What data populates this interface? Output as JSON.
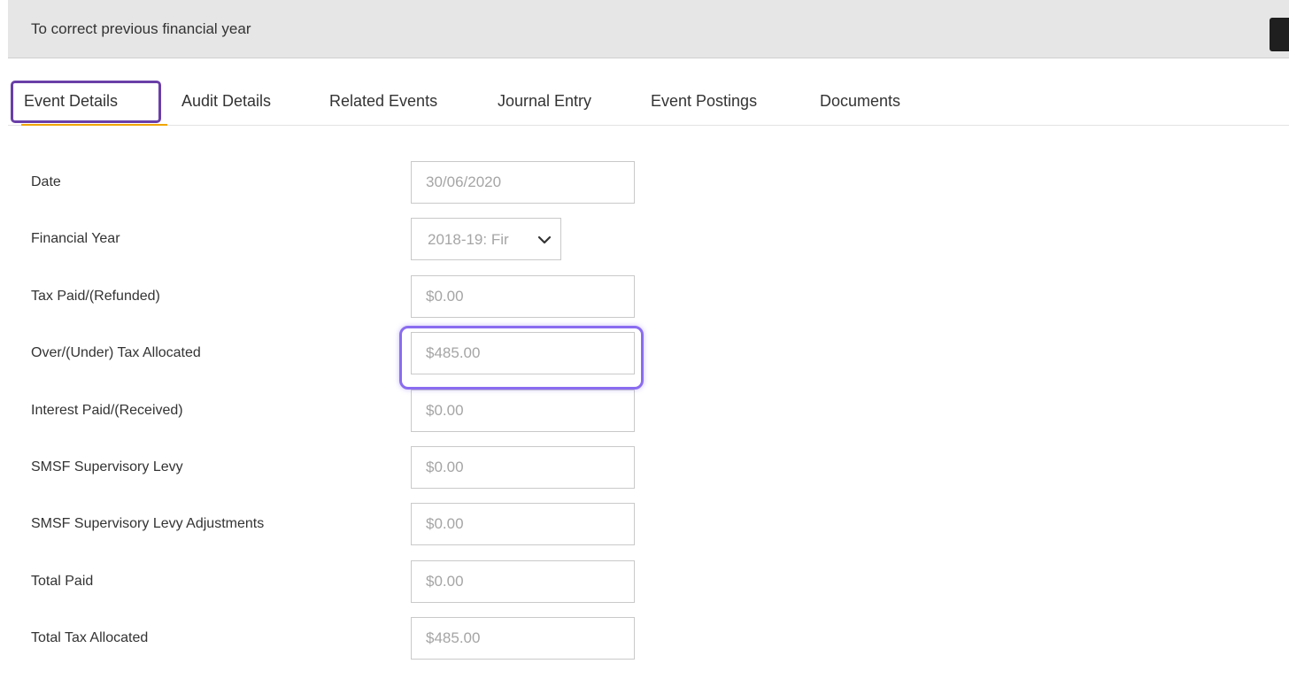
{
  "header": {
    "title": "To correct previous financial year"
  },
  "tabs": [
    {
      "label": "Event Details",
      "active": true
    },
    {
      "label": "Audit Details",
      "active": false
    },
    {
      "label": "Related Events",
      "active": false
    },
    {
      "label": "Journal Entry",
      "active": false
    },
    {
      "label": "Event Postings",
      "active": false
    },
    {
      "label": "Documents",
      "active": false
    }
  ],
  "form": {
    "date": {
      "label": "Date",
      "value": "30/06/2020"
    },
    "financial_year": {
      "label": "Financial Year",
      "value": "2018-19: Fir"
    },
    "tax_paid": {
      "label": "Tax Paid/(Refunded)",
      "value": "$0.00"
    },
    "over_under_tax": {
      "label": "Over/(Under) Tax Allocated",
      "value": "$485.00"
    },
    "interest_paid": {
      "label": "Interest Paid/(Received)",
      "value": "$0.00"
    },
    "smsf_levy": {
      "label": "SMSF Supervisory Levy",
      "value": "$0.00"
    },
    "smsf_levy_adj": {
      "label": "SMSF Supervisory Levy Adjustments",
      "value": "$0.00"
    },
    "total_paid": {
      "label": "Total Paid",
      "value": "$0.00"
    },
    "total_tax_allocated": {
      "label": "Total Tax Allocated",
      "value": "$485.00"
    }
  },
  "colors": {
    "tab_outline": "#6a3fa8",
    "tab_underline": "#f0a500",
    "field_highlight": "#8a6cf0",
    "header_bg": "#e6e6e6"
  }
}
